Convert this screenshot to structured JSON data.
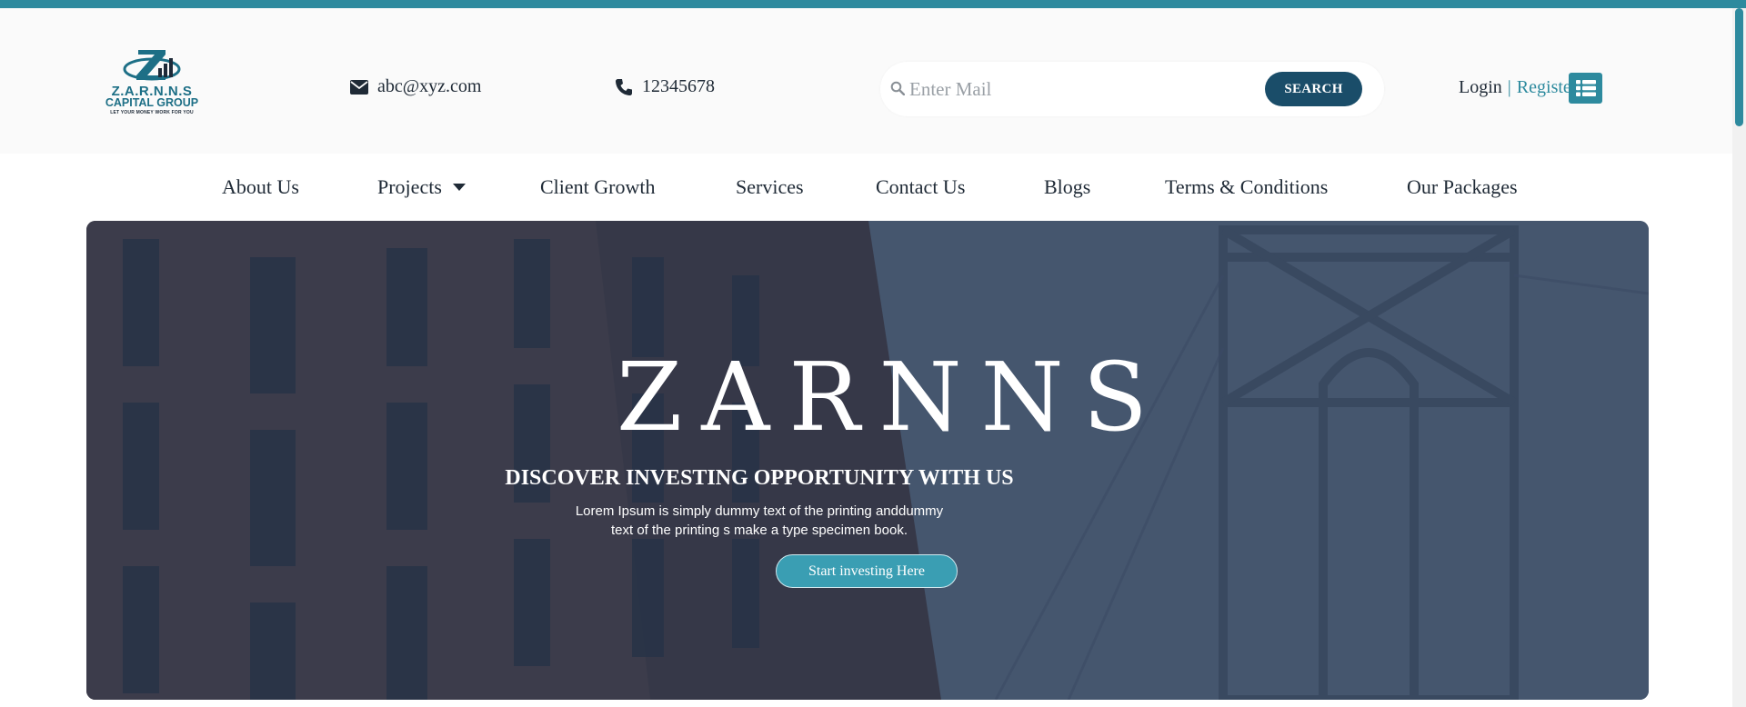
{
  "colors": {
    "accent": "#2d8a9e",
    "dark_button": "#1a4d69",
    "hero_overlay": "#243654"
  },
  "brand": {
    "logo_icon": "zarnns-logo-icon",
    "name": "Z.A.R.N.N.S",
    "subtitle": "CAPITAL GROUP",
    "tagline": "LET YOUR MONEY WORK FOR YOU"
  },
  "contact": {
    "email_icon": "envelope-icon",
    "email": "abc@xyz.com",
    "phone_icon": "phone-icon",
    "phone": "12345678"
  },
  "search": {
    "placeholder": "Enter Mail",
    "value": "",
    "button_label": "SEARCH"
  },
  "auth": {
    "login": "Login",
    "separator": "|",
    "register": "Register",
    "menu_icon": "list-icon"
  },
  "nav": {
    "items": [
      {
        "label": "About Us"
      },
      {
        "label": "Projects",
        "dropdown": true
      },
      {
        "label": "Client Growth"
      },
      {
        "label": "Services"
      },
      {
        "label": "Contact Us"
      },
      {
        "label": "Blogs"
      },
      {
        "label": "Terms & Conditions"
      },
      {
        "label": "Our Packages"
      }
    ]
  },
  "hero": {
    "title": "ZARNNS",
    "subtitle": "DISCOVER INVESTING OPPORTUNITY WITH US",
    "description_line1": "Lorem Ipsum is simply dummy text of the printing anddummy",
    "description_line2": "text of the printing s make a type specimen book.",
    "cta_label": "Start investing Here"
  }
}
